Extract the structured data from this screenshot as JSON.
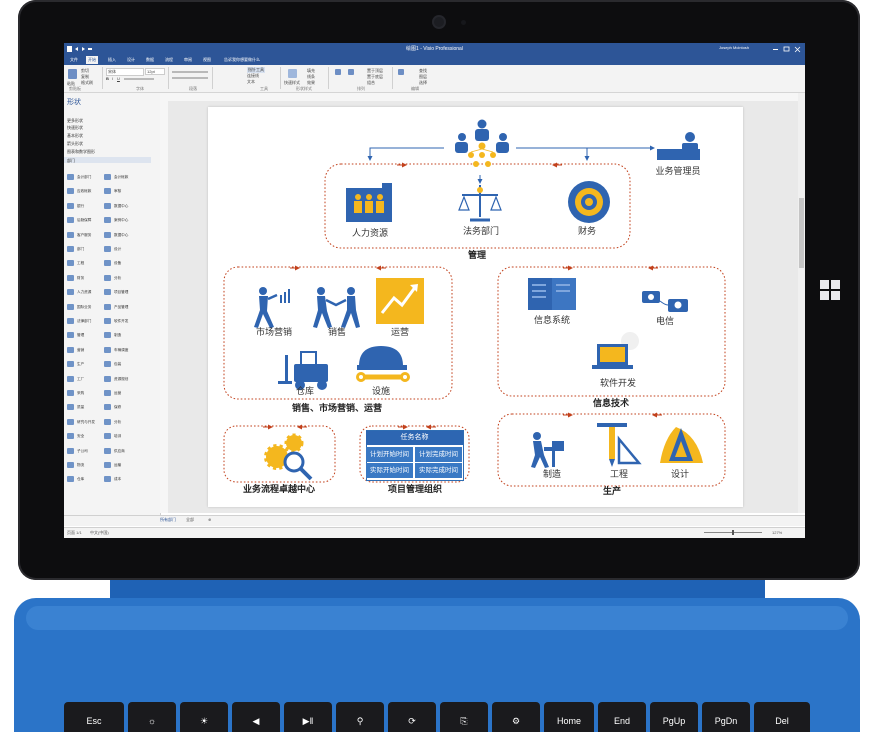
{
  "app": {
    "title": "绘图1 - Visio Professional",
    "user": "Joseph Mcintosh",
    "tabs": [
      "文件",
      "开始",
      "插入",
      "设计",
      "数据",
      "流程",
      "审阅",
      "视图"
    ],
    "active_tab_index": 1,
    "search_hint": "告诉我你想要做什么",
    "ribbon": {
      "font_name": "宋体",
      "font_size": "12pt",
      "paste": "粘贴",
      "cut": "剪切",
      "copy": "复制",
      "format_painter": "格式刷",
      "pointer_tool": "指针工具",
      "connector": "连接线",
      "text": "文本",
      "fill": "填充",
      "line": "线条",
      "effects": "效果",
      "quick_styles": "快速样式",
      "auto_align": "自动对齐和间距",
      "position": "位置",
      "bring_forward": "置于顶层",
      "send_backward": "置于底层",
      "group": "组合",
      "change_shape": "更改形状",
      "find": "查找",
      "layers": "图层",
      "select": "选择",
      "groups": [
        "剪贴板",
        "字体",
        "段落",
        "工具",
        "形状样式",
        "排列",
        "编辑"
      ]
    },
    "shapes_panel": {
      "title": "形状",
      "categories": [
        "更多形状",
        "快速形状",
        "基本形状",
        "箭头形状",
        "图表和数学图形",
        "部门"
      ],
      "selected_index": 5,
      "items_left": [
        "会计部门",
        "应收帐款",
        "银行",
        "后勤保障",
        "客户服务",
        "部门",
        "工程",
        "财务",
        "人力资源",
        "国际业务",
        "法律部门",
        "管理",
        "营销",
        "生产",
        "工厂",
        "采购",
        "质量",
        "研究与开发",
        "安全",
        "子公司",
        "物流",
        "仓库"
      ],
      "items_right": [
        "会计帐款",
        "审核",
        "数据中心",
        "案例中心",
        "数据中心",
        "设计",
        "设备",
        "分析",
        "项目管理",
        "产品管理",
        "软件开发",
        "制造",
        "车辆调度",
        "包装",
        "资源规划",
        "运营",
        "保修",
        "分析",
        "培训",
        "供应商",
        "运输",
        "成本"
      ]
    },
    "page_tabs": [
      "所有部门",
      "全部"
    ],
    "status": {
      "page": "页面 1/1",
      "language": "中文(中国)",
      "zoom": "127%"
    }
  },
  "diagram": {
    "top_role": "业务管理员",
    "groups": {
      "management": {
        "title": "管理",
        "items": [
          "人力资源",
          "法务部门",
          "财务"
        ]
      },
      "sales": {
        "title": "销售、市场营销、运营",
        "items": [
          "市场营销",
          "销售",
          "运营",
          "仓库",
          "设施"
        ]
      },
      "it": {
        "title": "信息技术",
        "items": [
          "信息系统",
          "电信",
          "软件开发"
        ]
      },
      "excellence": {
        "title": "业务流程卓越中心"
      },
      "pmo": {
        "title": "项目管理组织",
        "header": "任务名称",
        "cells": [
          "计划开始时间",
          "计划完成时间",
          "实际开始时间",
          "实际完成时间"
        ]
      },
      "production": {
        "title": "生产",
        "items": [
          "制造",
          "工程",
          "设计"
        ]
      }
    },
    "colors": {
      "blue": "#2f64b0",
      "orange": "#f4b71e",
      "dotted": "#c2411c"
    }
  },
  "keyboard": {
    "keys": [
      "Esc",
      "",
      "",
      "",
      "",
      "",
      "",
      "",
      "",
      "Home",
      "End",
      "PgUp",
      "PgDn",
      "Del"
    ]
  }
}
